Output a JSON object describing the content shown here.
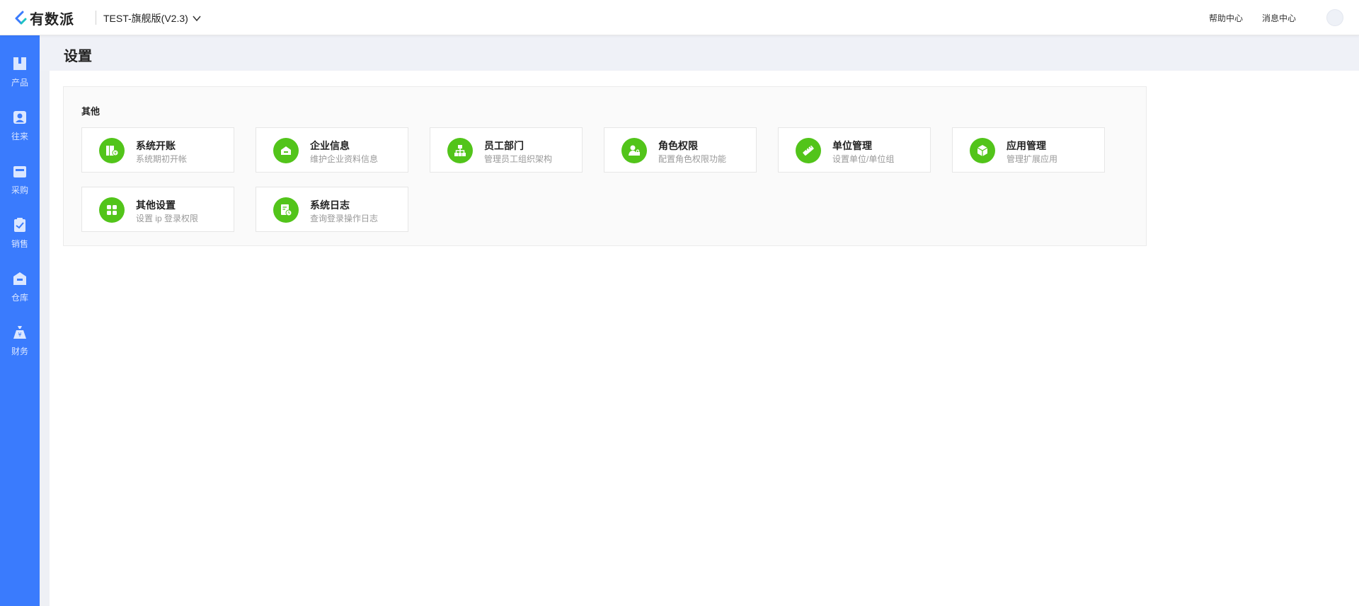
{
  "app": {
    "logo_text": "有数派",
    "version_label": "TEST-旗舰版(V2.3)",
    "help_center": "帮助中心",
    "message_center": "消息中心",
    "brand_color": "#3a7bfd",
    "accent_color": "#52c41a"
  },
  "sidebar": {
    "items": [
      {
        "label": "产品",
        "icon": "box-icon"
      },
      {
        "label": "往来",
        "icon": "contact-card-icon"
      },
      {
        "label": "采购",
        "icon": "basket-icon"
      },
      {
        "label": "销售",
        "icon": "clipboard-check-icon"
      },
      {
        "label": "仓库",
        "icon": "warehouse-icon"
      },
      {
        "label": "财务",
        "icon": "money-bag-icon"
      }
    ]
  },
  "page": {
    "title": "设置"
  },
  "settings": {
    "section_title": "其他",
    "cards": [
      {
        "title": "系统开账",
        "desc": "系统期初开帐",
        "icon": "ledger-icon"
      },
      {
        "title": "企业信息",
        "desc": "维护企业资料信息",
        "icon": "building-icon"
      },
      {
        "title": "员工部门",
        "desc": "管理员工组织架构",
        "icon": "org-chart-icon"
      },
      {
        "title": "角色权限",
        "desc": "配置角色权限功能",
        "icon": "user-lock-icon"
      },
      {
        "title": "单位管理",
        "desc": "设置单位/单位组",
        "icon": "ruler-icon"
      },
      {
        "title": "应用管理",
        "desc": "管理扩展应用",
        "icon": "cube-icon"
      },
      {
        "title": "其他设置",
        "desc": "设置 ip 登录权限",
        "icon": "grid-icon"
      },
      {
        "title": "系统日志",
        "desc": "查询登录操作日志",
        "icon": "log-clock-icon"
      }
    ]
  }
}
